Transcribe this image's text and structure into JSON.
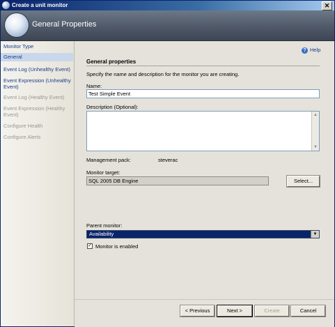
{
  "window": {
    "title": "Create a unit monitor",
    "close_glyph": "✕"
  },
  "banner": {
    "title": "General Properties"
  },
  "sidebar": {
    "items": [
      {
        "label": "Monitor Type",
        "state": "enabled"
      },
      {
        "label": "General",
        "state": "selected"
      },
      {
        "label": "Event Log (Unhealthy Event)",
        "state": "enabled"
      },
      {
        "label": "Event Expression (Unhealthy Event)",
        "state": "enabled"
      },
      {
        "label": "Event Log (Healthy Event)",
        "state": "disabled"
      },
      {
        "label": "Event Expression (Healthy Event)",
        "state": "disabled"
      },
      {
        "label": "Configure Health",
        "state": "disabled"
      },
      {
        "label": "Configure Alerts",
        "state": "disabled"
      }
    ]
  },
  "main": {
    "help_label": "Help",
    "section_title": "General properties",
    "instructions": "Specify the name and description for the monitor you are creating.",
    "name_label": "Name:",
    "name_value": "Test Simple Event",
    "description_label": "Description (Optional):",
    "description_value": "",
    "management_pack_label": "Management pack:",
    "management_pack_value": "steverac",
    "monitor_target_label": "Monitor target:",
    "monitor_target_value": "SQL 2005 DB Engine",
    "select_button": "Select...",
    "parent_monitor_label": "Parent monitor:",
    "parent_monitor_value": "Availability",
    "enabled_label": "Monitor is enabled",
    "enabled_checked": true
  },
  "footer": {
    "previous": "< Previous",
    "next": "Next >",
    "create": "Create",
    "cancel": "Cancel"
  },
  "colors": {
    "title_bar": "#0a246a",
    "nav_link": "#1c3c8c",
    "selection": "#0a246a",
    "content_bg": "#e4e2da"
  }
}
